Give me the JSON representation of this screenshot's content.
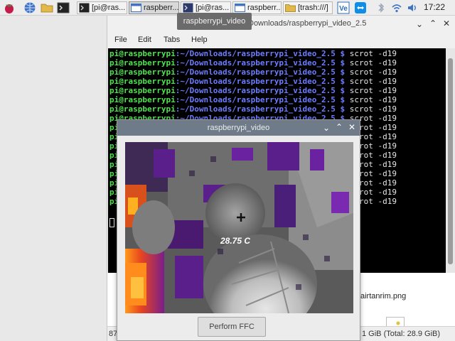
{
  "taskbar": {
    "tasks": [
      {
        "label": "[pi@ras..."
      },
      {
        "label": "raspberr..."
      },
      {
        "label": "[pi@ras..."
      },
      {
        "label": "raspberr..."
      },
      {
        "label": "[trash:///]"
      }
    ],
    "clock": "17:22"
  },
  "tooltip": {
    "text": "raspberrypi_video"
  },
  "terminal": {
    "title": "Downloads/raspberrypi_video_2.5",
    "menu": [
      "File",
      "Edit",
      "Tabs",
      "Help"
    ],
    "prompt_user": "pi@raspberrypi",
    "prompt_path": ":~/Downloads/raspberrypi_video_2.5 $",
    "command": " scrot -d19",
    "line_count": 17
  },
  "file_manager": {
    "file_label": "airtanrim.png",
    "status_left": "87",
    "status_right": "1 GiB (Total: 28.9 GiB)"
  },
  "video_window": {
    "title": "raspberrypi_video",
    "temperature": "28.75 C",
    "ffc_button": "Perform FFC"
  },
  "colors": {
    "prompt_user": "#4ee44e",
    "prompt_path": "#6d7cff",
    "video_titlebar": "#6f7b88"
  }
}
